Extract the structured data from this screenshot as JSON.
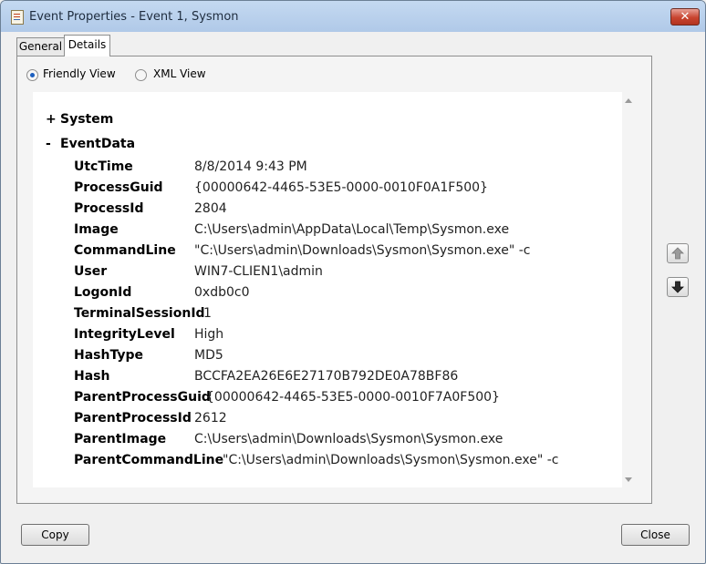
{
  "window": {
    "title": "Event Properties - Event 1, Sysmon",
    "close_glyph": "✕"
  },
  "tabs": [
    {
      "label": "General",
      "active": false
    },
    {
      "label": "Details",
      "active": true
    }
  ],
  "view_options": [
    {
      "label": "Friendly View",
      "selected": true
    },
    {
      "label": "XML View",
      "selected": false
    }
  ],
  "sections": [
    {
      "toggle": "+",
      "label": "System",
      "expanded": false
    },
    {
      "toggle": "-",
      "label": "EventData",
      "expanded": true
    }
  ],
  "event_data": [
    {
      "key": "UtcTime",
      "value": "8/8/2014 9:43 PM"
    },
    {
      "key": "ProcessGuid",
      "value": "{00000642-4465-53E5-0000-0010F0A1F500}"
    },
    {
      "key": "ProcessId",
      "value": "2804"
    },
    {
      "key": "Image",
      "value": "C:\\Users\\admin\\AppData\\Local\\Temp\\Sysmon.exe"
    },
    {
      "key": "CommandLine",
      "value": "\"C:\\Users\\admin\\Downloads\\Sysmon\\Sysmon.exe\" -c"
    },
    {
      "key": "User",
      "value": "WIN7-CLIEN1\\admin"
    },
    {
      "key": "LogonId",
      "value": "0xdb0c0"
    },
    {
      "key": "TerminalSessionId",
      "value": "1"
    },
    {
      "key": "IntegrityLevel",
      "value": "High"
    },
    {
      "key": "HashType",
      "value": "MD5"
    },
    {
      "key": "Hash",
      "value": "BCCFA2EA26E6E27170B792DE0A78BF86"
    },
    {
      "key": "ParentProcessGuid",
      "value": "{00000642-4465-53E5-0000-0010F7A0F500}"
    },
    {
      "key": "ParentProcessId",
      "value": "2612"
    },
    {
      "key": "ParentImage",
      "value": "C:\\Users\\admin\\Downloads\\Sysmon\\Sysmon.exe"
    },
    {
      "key": "ParentCommandLine",
      "value": "\"C:\\Users\\admin\\Downloads\\Sysmon\\Sysmon.exe\" -c"
    }
  ],
  "buttons": {
    "copy": "Copy",
    "close": "Close"
  },
  "icons": {
    "app": "event-viewer-icon",
    "move_up": "up-arrow-icon",
    "move_down": "down-arrow-icon"
  }
}
